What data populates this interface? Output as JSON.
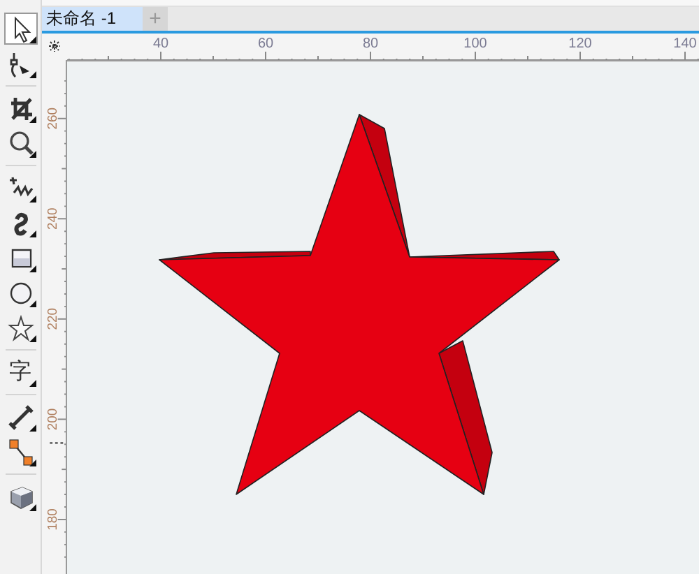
{
  "document_tabs": [
    {
      "label": "未命名 -1",
      "selected": true
    }
  ],
  "new_tab_button": {
    "label": "+"
  },
  "toolbox": [
    {
      "kind": "pointer",
      "selected": true
    },
    {
      "kind": "shape",
      "selected": false
    },
    {
      "kind": "crop",
      "selected": false
    },
    {
      "kind": "zoom",
      "selected": false
    },
    {
      "kind": "freehand",
      "selected": false
    },
    {
      "kind": "artistic",
      "selected": false
    },
    {
      "kind": "rectangle",
      "selected": false
    },
    {
      "kind": "ellipse",
      "selected": false
    },
    {
      "kind": "polygon",
      "selected": false
    },
    {
      "kind": "text",
      "label": "字",
      "selected": false
    },
    {
      "kind": "dimension",
      "selected": false
    },
    {
      "kind": "connector",
      "selected": false
    },
    {
      "kind": "extrude",
      "selected": false
    }
  ],
  "horizontal_ruler": {
    "labels": [
      "40",
      "60",
      "80",
      "100",
      "120",
      "140"
    ]
  },
  "vertical_ruler": {
    "labels": [
      "260",
      "240",
      "220",
      "200",
      "180"
    ]
  }
}
